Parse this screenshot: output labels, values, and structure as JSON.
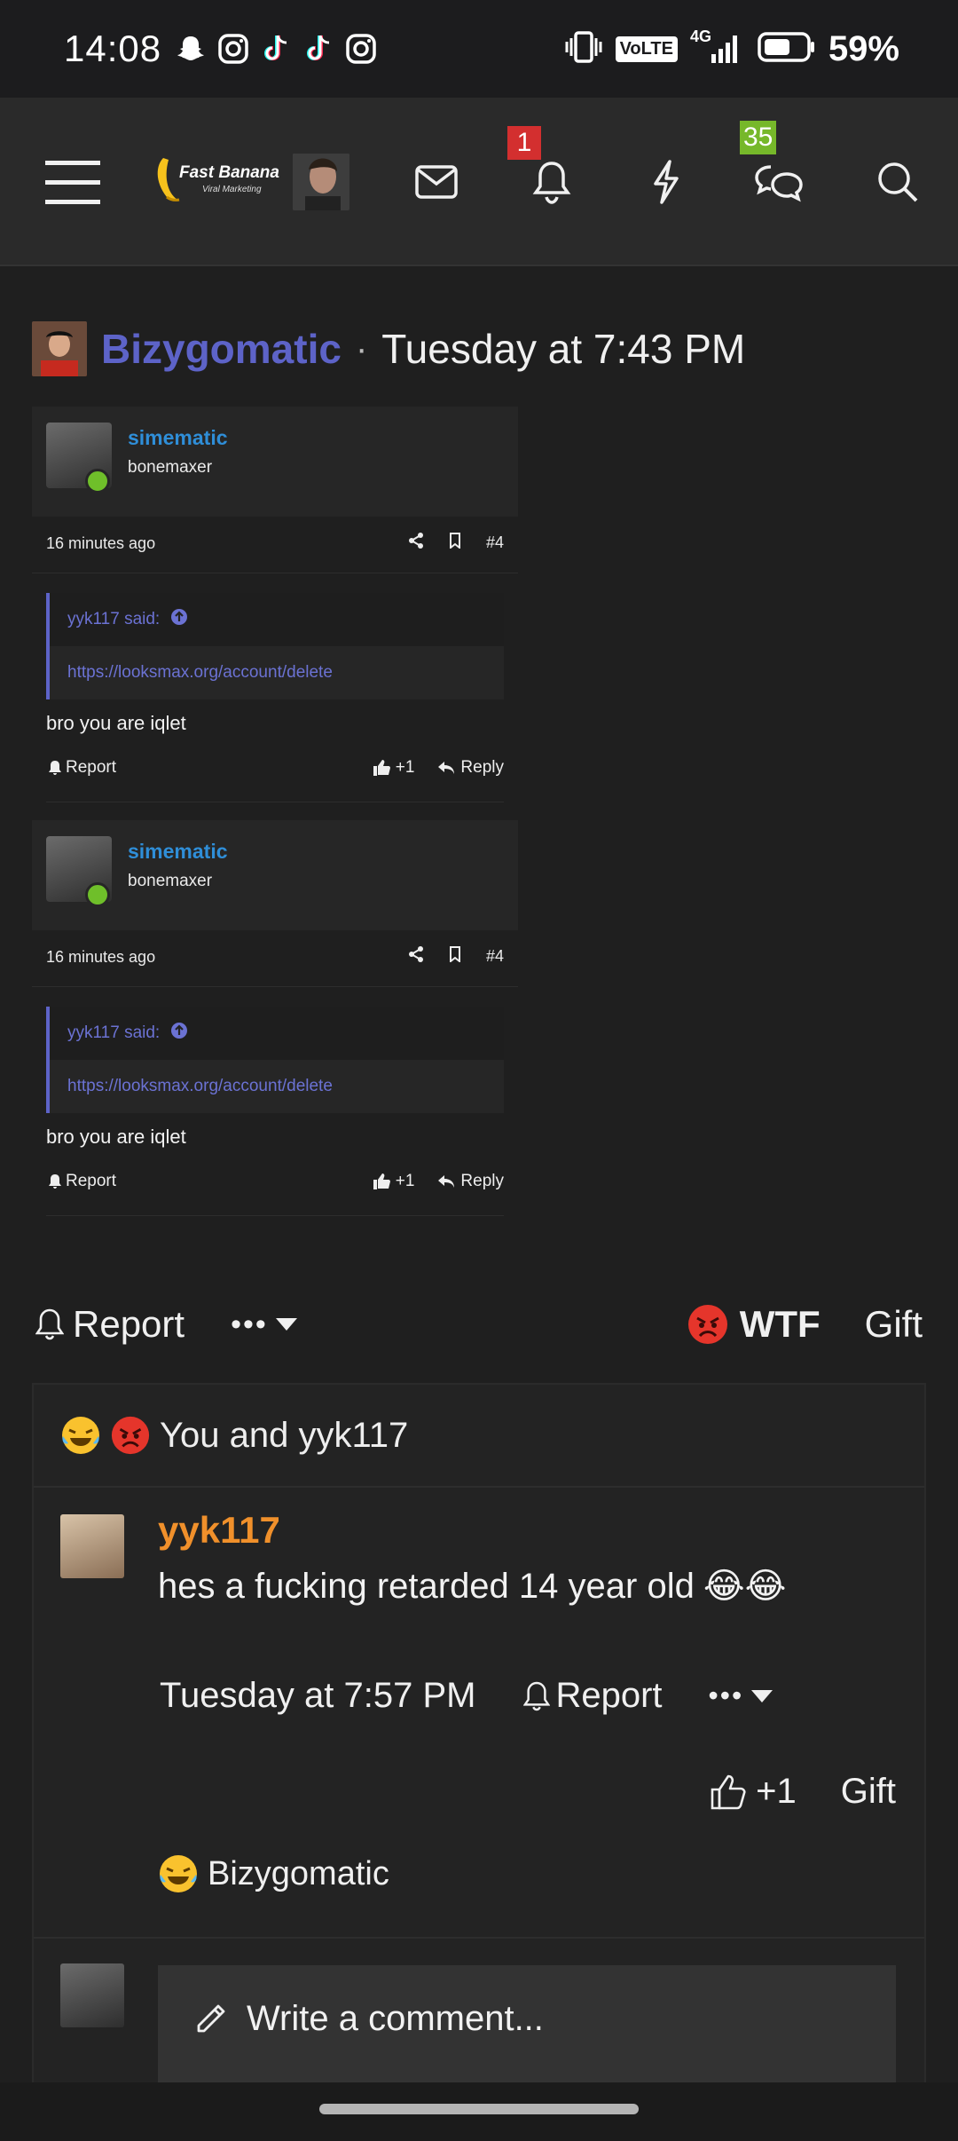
{
  "status_bar": {
    "time": "14:08",
    "battery_percent": "59%",
    "network": "4G",
    "volte": "VoLTE",
    "notification_icons": [
      "snapchat-icon",
      "instagram-icon",
      "tiktok-icon",
      "tiktok-icon",
      "instagram-icon"
    ]
  },
  "nav": {
    "logo_text": "Fast Banana",
    "logo_subtext": "Viral Marketing",
    "notifications_badge": "1",
    "conversations_badge": "35"
  },
  "thread": {
    "user": "Bizygomatic",
    "separator": "·",
    "time": "Tuesday at 7:43 PM"
  },
  "embeds": [
    {
      "username": "simematic",
      "user_title": "bonemaxer",
      "time_ago": "16 minutes ago",
      "post_number": "#4",
      "quote_author": "yyk117 said:",
      "quote_text": "https://looksmax.org/account/delete",
      "text": "bro you are iqlet",
      "report_label": "Report",
      "like_label": "+1",
      "reply_label": "Reply"
    },
    {
      "username": "simematic",
      "user_title": "bonemaxer",
      "time_ago": "16 minutes ago",
      "post_number": "#4",
      "quote_author": "yyk117 said:",
      "quote_text": "https://looksmax.org/account/delete",
      "text": "bro you are iqlet",
      "report_label": "Report",
      "like_label": "+1",
      "reply_label": "Reply"
    }
  ],
  "actions": {
    "report_label": "Report",
    "more_label": "•••",
    "reaction_label": "WTF",
    "gift_label": "Gift"
  },
  "comments": {
    "reactions_summary": "You and yyk117",
    "items": [
      {
        "username": "yyk117",
        "text": "hes a fucking retarded 14 year old",
        "emoji": "😂😂",
        "time": "Tuesday at 7:57 PM",
        "report_label": "Report",
        "more_label": "•••",
        "like_label": "+1",
        "gift_label": "Gift",
        "reactor": "Bizygomatic"
      }
    ],
    "write_placeholder": "Write a comment..."
  },
  "colors": {
    "accent_blue": "#5d63c8",
    "link_blue": "#2f8ed8",
    "orange_user": "#f0902b",
    "online_green": "#6fbf2a",
    "badge_red": "#d32f2f",
    "badge_green": "#76b82a"
  }
}
